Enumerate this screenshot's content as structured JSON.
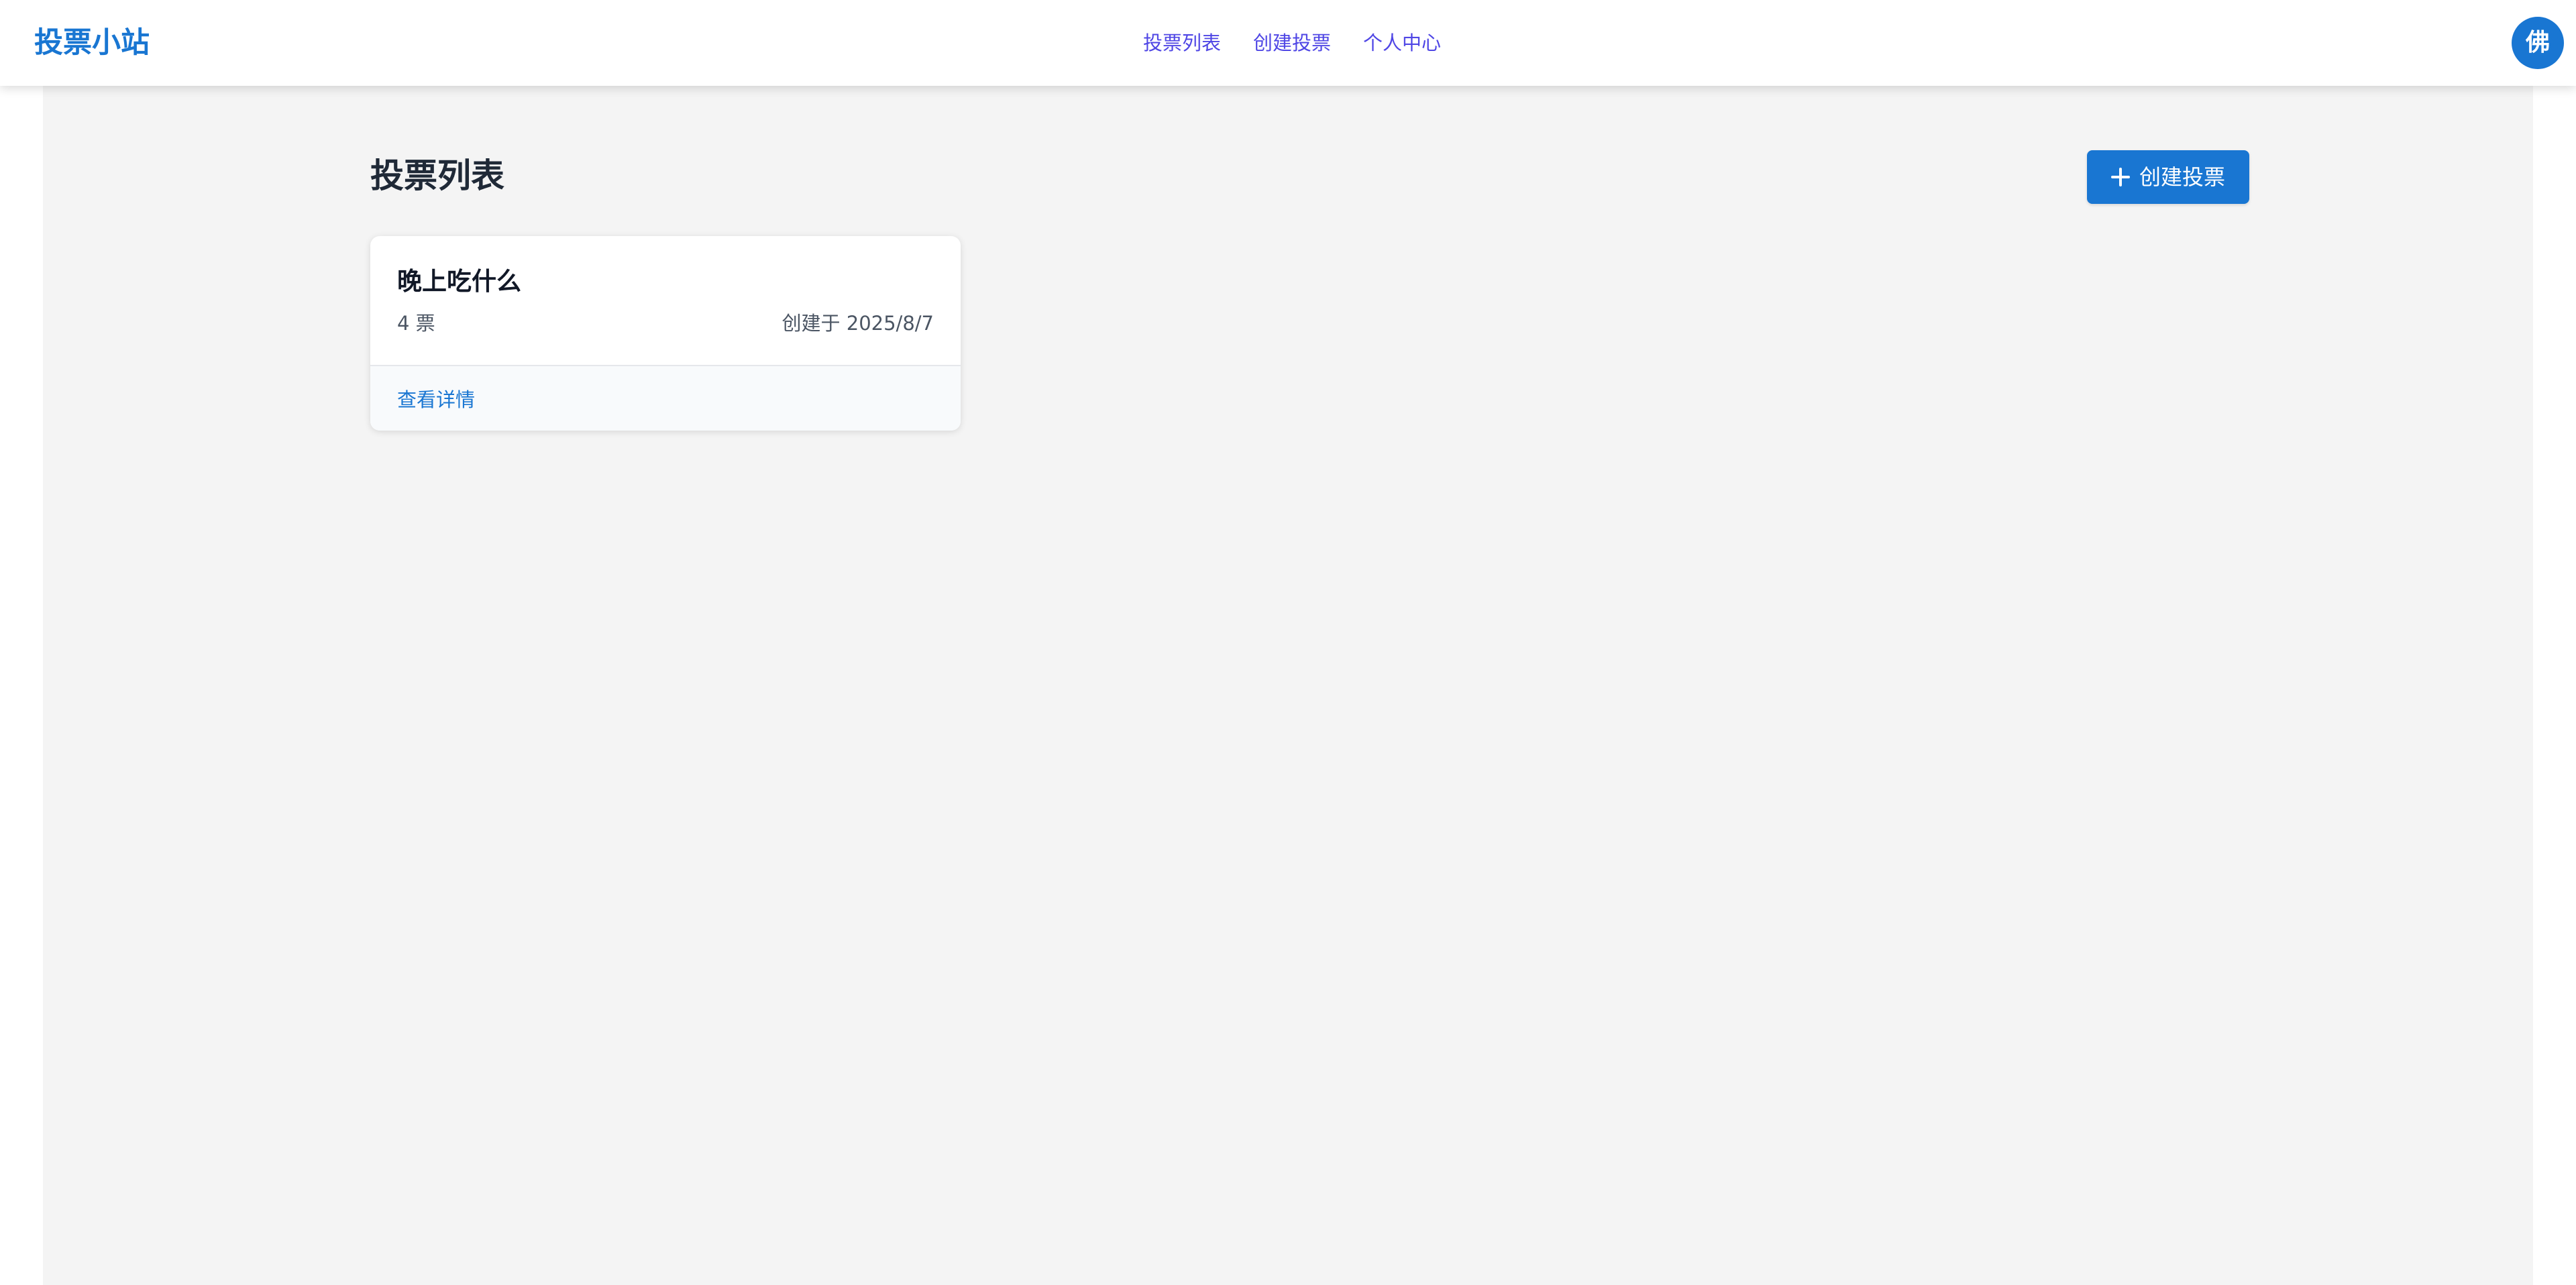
{
  "header": {
    "brand": "投票小站",
    "nav": [
      {
        "label": "投票列表"
      },
      {
        "label": "创建投票"
      },
      {
        "label": "个人中心"
      }
    ],
    "avatar_initial": "佛"
  },
  "main": {
    "title": "投票列表",
    "create_button_label": "创建投票",
    "polls": [
      {
        "title": "晚上吃什么",
        "votes": "4 票",
        "created": "创建于 2025/8/7",
        "detail_link": "查看详情"
      }
    ]
  },
  "colors": {
    "primary": "#1976d2",
    "nav_link": "#4f46e5",
    "page_background": "#f4f4f4"
  },
  "icons": {
    "create_button": "plus-icon"
  }
}
